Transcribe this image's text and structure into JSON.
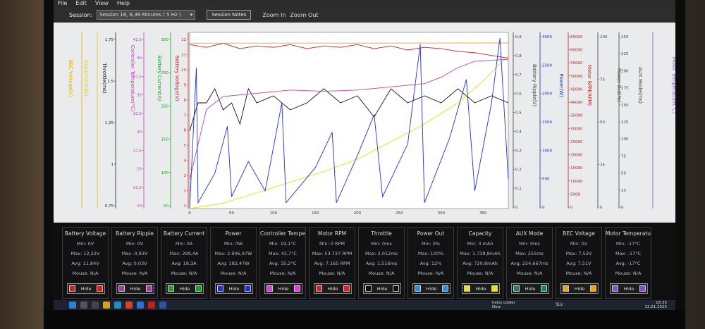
{
  "menu": [
    "File",
    "Edit",
    "View",
    "Help"
  ],
  "toolbar": {
    "session_label": "Session:",
    "session_value": "Session 18, 6,38 Minutes ( 5 Hz )",
    "session_notes_label": "Session Notes",
    "zoom_in_label": "Zoom In",
    "zoom_out_label": "Zoom Out"
  },
  "left_axes": [
    {
      "label": "BEC Voltage(V)",
      "color": "#e8b000",
      "ticks": []
    },
    {
      "label": "Capacity(mAh)",
      "color": "#e8c800",
      "ticks": []
    },
    {
      "label": "Throttle(ms)",
      "color": "#202020",
      "ticks": [
        "1,75",
        "1,5",
        "1,25",
        "1",
        "0,75"
      ]
    },
    {
      "label": "Controller Temperature(°C)",
      "color": "#c040c0",
      "ticks": [
        "42,5",
        "40",
        "37,5",
        "35",
        "32,5",
        "30",
        "27,5",
        "25",
        "22,5",
        "20"
      ]
    },
    {
      "label": "Battery Current(A)",
      "color": "#20a020",
      "ticks": [
        "300",
        "250",
        "200",
        "150",
        "100",
        "50"
      ]
    },
    {
      "label": "Battery Voltage(V)",
      "color": "#d02020",
      "ticks": [
        "12",
        "11",
        "10",
        "9",
        "8",
        "7",
        "6",
        "5",
        "4",
        "3",
        "2",
        "1"
      ]
    }
  ],
  "right_axes": [
    {
      "label": "Battery Ripple(V)",
      "color": "#404040",
      "ticks": [
        "0,9",
        "0,8",
        "0,7",
        "0,6",
        "0,5",
        "0,4",
        "0,3",
        "0,2",
        "0,1",
        "0"
      ]
    },
    {
      "label": "Power(W)",
      "color": "#2030c0",
      "ticks": [
        "3000",
        "2500",
        "2000",
        "1500",
        "1000",
        "500",
        "0"
      ]
    },
    {
      "label": "Motor RPM(RPM)",
      "color": "#c02020",
      "ticks": [
        "65000",
        "60000",
        "55000",
        "50000",
        "45000",
        "40000",
        "35000",
        "30000",
        "25000",
        "20000",
        "15000",
        "10000",
        "5000",
        "0"
      ]
    },
    {
      "label": "Power Out(%)",
      "color": "#404040",
      "ticks": [
        "100",
        "75",
        "50",
        "25",
        "0"
      ]
    },
    {
      "label": "AUX Mode(ms)",
      "color": "#404040",
      "ticks": [
        "250",
        "225",
        "200",
        "175",
        "150",
        "125",
        "100",
        "75",
        "50",
        "25",
        "0"
      ]
    },
    {
      "label": "Motor Temperature(°C)",
      "color": "#8060c0",
      "ticks": []
    }
  ],
  "x_ticks": [
    "0",
    "50",
    "100",
    "150",
    "200",
    "250",
    "300",
    "350"
  ],
  "panels": [
    {
      "title": "Battery Voltage",
      "min": "Min: 0V",
      "max": "Max: 12,22V",
      "avg": "Avg: 11,84V",
      "mouse": "Mouse: N/A",
      "hide": "Hide",
      "color": "#d02020"
    },
    {
      "title": "Battery Ripple",
      "min": "Min: 0V",
      "max": "Max: 0,93V",
      "avg": "Avg: 0,03V",
      "mouse": "Mouse: N/A",
      "hide": "Hide",
      "color": "#a040a0"
    },
    {
      "title": "Battery Current",
      "min": "Min: 0A",
      "max": "Max: 299,4A",
      "avg": "Avg: 18,3A",
      "mouse": "Mouse: N/A",
      "hide": "Hide",
      "color": "#20a020"
    },
    {
      "title": "Power",
      "min": "Min: 0W",
      "max": "Max: 2.906,97W",
      "avg": "Avg: 182,47W",
      "mouse": "Mouse: N/A",
      "hide": "Hide",
      "color": "#2030e0"
    },
    {
      "title": "Controller Temperature",
      "min": "Min: 19,1°C",
      "max": "Max: 42,7°C",
      "avg": "Avg: 35,2°C",
      "mouse": "Mouse: N/A",
      "hide": "Hide",
      "color": "#e040e0"
    },
    {
      "title": "Motor RPM",
      "min": "Min: 0 RPM",
      "max": "Max: 53.737 RPM",
      "avg": "Avg: 7.165 RPM",
      "mouse": "Mouse: N/A",
      "hide": "Hide",
      "color": "#e02020"
    },
    {
      "title": "Throttle",
      "min": "Min: 0ms",
      "max": "Max: 2,012ms",
      "avg": "Avg: 1,516ms",
      "mouse": "Mouse: N/A",
      "hide": "Hide",
      "color": "#101010"
    },
    {
      "title": "Power Out",
      "min": "Min: 0%",
      "max": "Max: 100%",
      "avg": "Avg: 12%",
      "mouse": "Mouse: N/A",
      "hide": "Hide",
      "color": "#3090e0"
    },
    {
      "title": "Capacity",
      "min": "Min: 3 mAh",
      "max": "Max: 1.738,8mAh",
      "avg": "Avg: 720,8mAh",
      "mouse": "Mouse: N/A",
      "hide": "Hide",
      "color": "#f0e020"
    },
    {
      "title": "AUX Mode",
      "min": "Min: 0ms",
      "max": "Max: 255ms",
      "avg": "Avg: 254,667ms",
      "mouse": "Mouse: N/A",
      "hide": "Hide",
      "color": "#208070"
    },
    {
      "title": "BEC Voltage",
      "min": "Min: 0V",
      "max": "Max: 7,52V",
      "avg": "Avg: 7,51V",
      "mouse": "Mouse: N/A",
      "hide": "Hide",
      "color": "#f0a020"
    },
    {
      "title": "Motor Temperature",
      "min": "Min: -17°C",
      "max": "Max: -17°C",
      "avg": "Avg: -17°C",
      "mouse": "Mouse: N/A",
      "hide": "Hide",
      "color": "#8050d0"
    }
  ],
  "taskbar": {
    "weather_line1": "heiss colder",
    "weather_line2": "Now",
    "tray": "SLV",
    "time": "18:35",
    "date": "12.01.2025"
  },
  "chart_data": {
    "type": "line",
    "x_range": [
      0,
      380
    ],
    "series": [
      {
        "name": "Battery Voltage",
        "color": "#d02020",
        "y_range": [
          0,
          13
        ],
        "values": [
          [
            0,
            12.1
          ],
          [
            20,
            11.9
          ],
          [
            40,
            12.2
          ],
          [
            60,
            11.8
          ],
          [
            80,
            12.0
          ],
          [
            100,
            11.9
          ],
          [
            120,
            12.1
          ],
          [
            140,
            11.8
          ],
          [
            160,
            12.0
          ],
          [
            180,
            11.9
          ],
          [
            200,
            12.1
          ],
          [
            220,
            11.8
          ],
          [
            240,
            12.0
          ],
          [
            260,
            11.7
          ],
          [
            280,
            11.9
          ],
          [
            300,
            11.8
          ],
          [
            320,
            11.6
          ],
          [
            340,
            11.5
          ],
          [
            360,
            11.3
          ],
          [
            380,
            11.1
          ]
        ]
      },
      {
        "name": "Throttle",
        "color": "#111111",
        "y_range": [
          0.75,
          2.0
        ],
        "values": [
          [
            0,
            1.3
          ],
          [
            10,
            1.5
          ],
          [
            20,
            1.5
          ],
          [
            30,
            1.6
          ],
          [
            40,
            1.45
          ],
          [
            50,
            1.5
          ],
          [
            60,
            1.35
          ],
          [
            70,
            1.6
          ],
          [
            80,
            1.5
          ],
          [
            100,
            1.55
          ],
          [
            120,
            1.45
          ],
          [
            140,
            1.5
          ],
          [
            160,
            1.6
          ],
          [
            180,
            1.5
          ],
          [
            200,
            1.55
          ],
          [
            220,
            1.4
          ],
          [
            240,
            1.6
          ],
          [
            260,
            1.5
          ],
          [
            280,
            1.55
          ],
          [
            300,
            1.5
          ],
          [
            320,
            1.6
          ],
          [
            340,
            1.5
          ],
          [
            360,
            1.55
          ],
          [
            380,
            1.5
          ]
        ]
      },
      {
        "name": "Capacity",
        "color": "#e8e000",
        "y_range": [
          0,
          2000
        ],
        "values": [
          [
            0,
            0
          ],
          [
            40,
            60
          ],
          [
            80,
            180
          ],
          [
            120,
            300
          ],
          [
            160,
            420
          ],
          [
            200,
            560
          ],
          [
            240,
            760
          ],
          [
            280,
            960
          ],
          [
            320,
            1200
          ],
          [
            350,
            1450
          ],
          [
            380,
            1738
          ]
        ]
      },
      {
        "name": "Controller Temperature",
        "color": "#c040c0",
        "y_range": [
          17.5,
          45
        ],
        "values": [
          [
            0,
            22
          ],
          [
            20,
            33
          ],
          [
            40,
            35
          ],
          [
            80,
            35.5
          ],
          [
            120,
            36
          ],
          [
            160,
            35.8
          ],
          [
            200,
            36
          ],
          [
            240,
            36.5
          ],
          [
            280,
            37
          ],
          [
            300,
            38
          ],
          [
            320,
            39.5
          ],
          [
            340,
            40.5
          ],
          [
            380,
            40.8
          ]
        ]
      },
      {
        "name": "BEC Voltage",
        "color": "#f0a020",
        "y_range": [
          0,
          8
        ],
        "values": [
          [
            0,
            7.51
          ],
          [
            380,
            7.52
          ]
        ]
      },
      {
        "name": "Power",
        "color": "#2030e0",
        "y_range": [
          0,
          3000
        ],
        "values": [
          [
            0,
            0
          ],
          [
            8,
            2400
          ],
          [
            10,
            100
          ],
          [
            30,
            600
          ],
          [
            45,
            1400
          ],
          [
            50,
            200
          ],
          [
            70,
            800
          ],
          [
            90,
            300
          ],
          [
            110,
            1800
          ],
          [
            115,
            100
          ],
          [
            150,
            700
          ],
          [
            170,
            1300
          ],
          [
            175,
            100
          ],
          [
            200,
            900
          ],
          [
            220,
            1600
          ],
          [
            230,
            200
          ],
          [
            260,
            1100
          ],
          [
            275,
            2800
          ],
          [
            280,
            100
          ],
          [
            310,
            1200
          ],
          [
            330,
            2200
          ],
          [
            340,
            300
          ],
          [
            360,
            1800
          ],
          [
            370,
            2900
          ],
          [
            380,
            500
          ]
        ]
      }
    ]
  }
}
